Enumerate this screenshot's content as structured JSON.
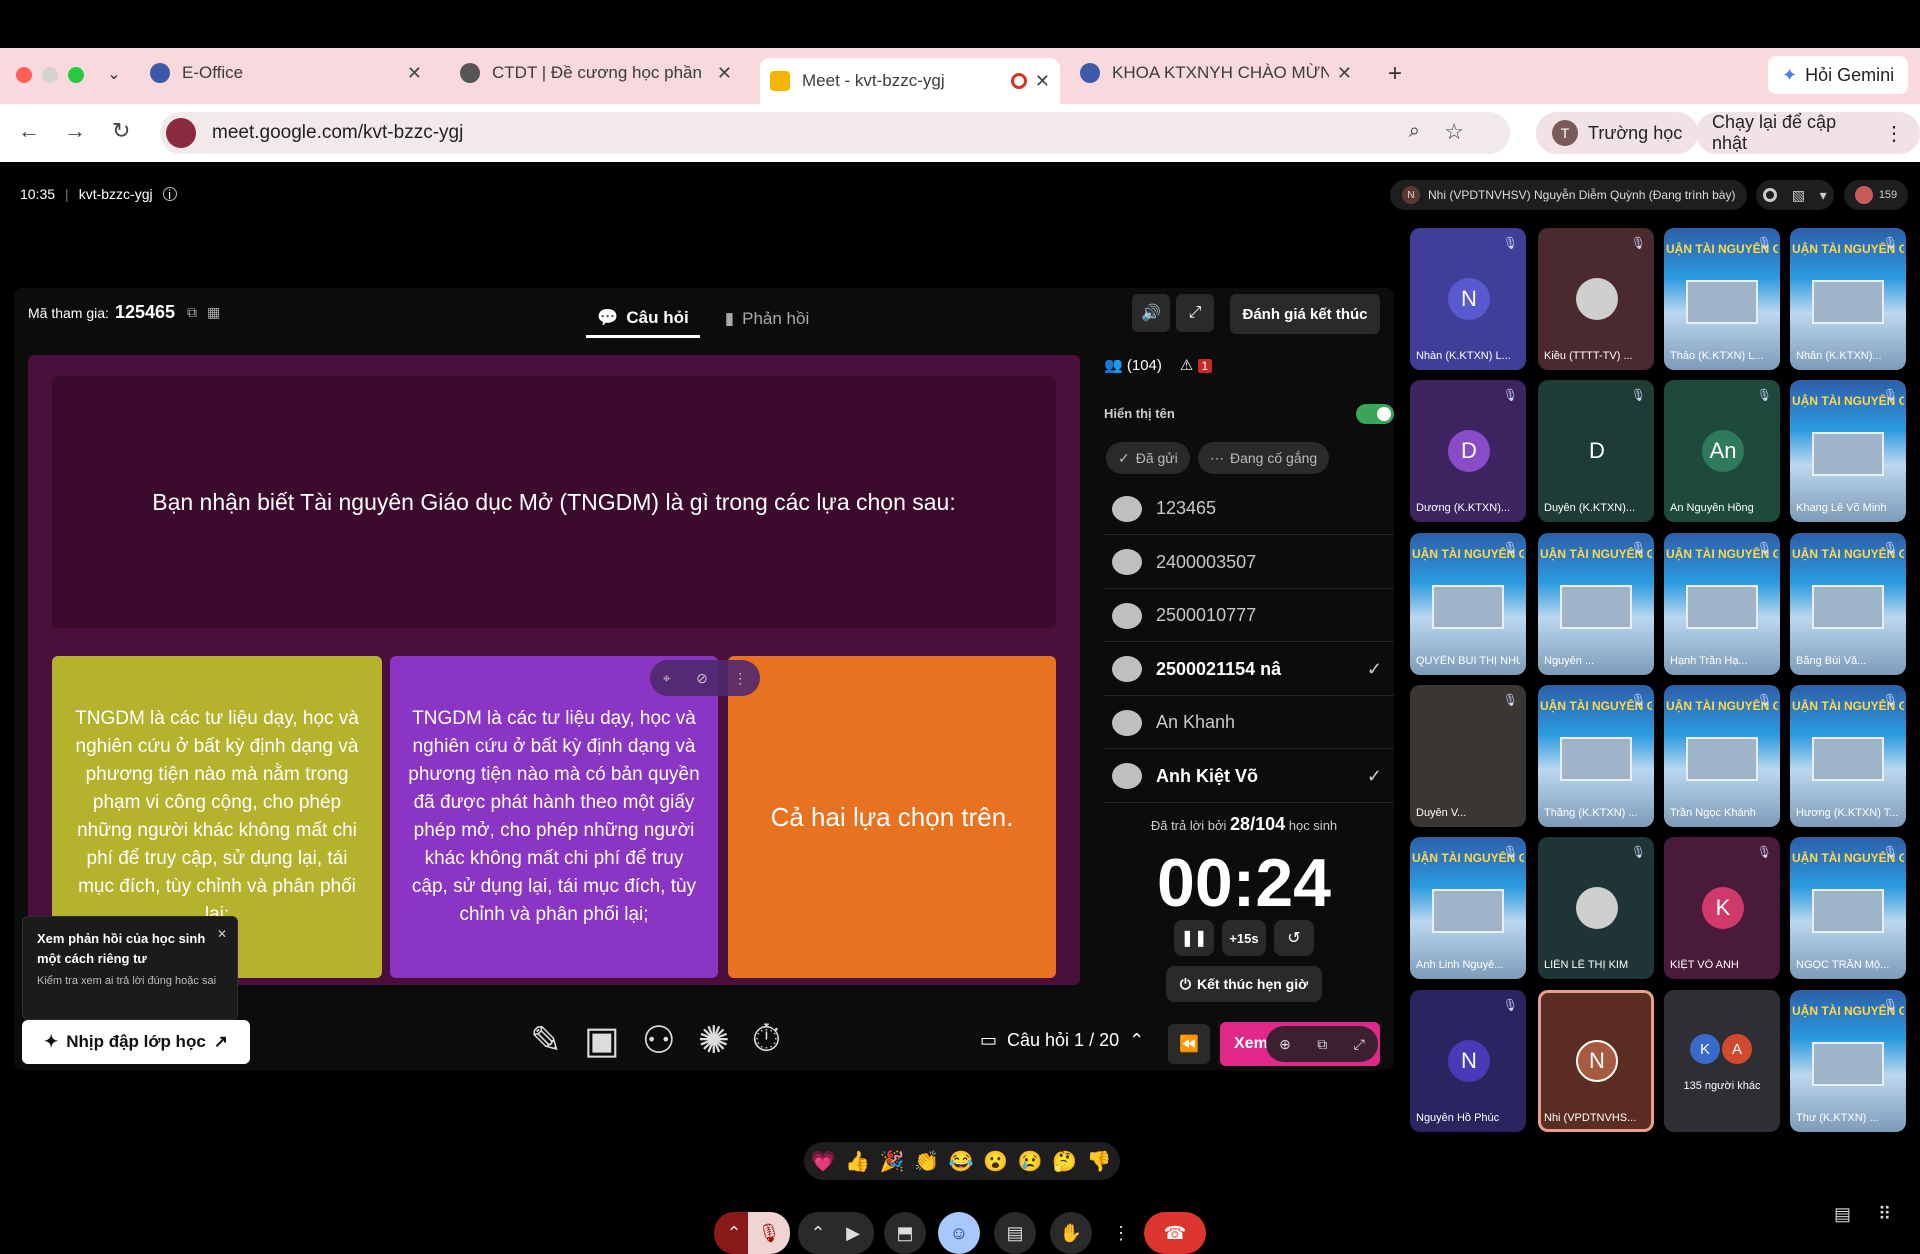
{
  "browser": {
    "tabs": [
      {
        "title": "E-Office",
        "color": "#3d5aa8"
      },
      {
        "title": "CTDT | Đề cương học phần",
        "color": "#555555"
      },
      {
        "title": "Meet - kvt-bzzc-ygj",
        "color": "#f4b400"
      },
      {
        "title": "KHOA KTXNYH CHÀO MỪNG",
        "color": "#3d5aa8"
      }
    ],
    "gemini_label": "Hỏi Gemini",
    "url": "meet.google.com/kvt-bzzc-ygj",
    "profile_initial": "T",
    "profile_label": "Trường học",
    "update_label": "Chạy lại để cập nhật"
  },
  "meet": {
    "time": "10:35",
    "separator": "|",
    "code": "kvt-bzzc-ygj",
    "presenter_initial": "N",
    "presenter": "Nhi (VPDTNVHSV) Nguyễn Diễm Quỳnh (Đang trình bày)",
    "participant_count": "159"
  },
  "quiz": {
    "join_label": "Mã tham gia:",
    "join_code": "125465",
    "tab_question": "Câu hỏi",
    "tab_response": "Phản hồi",
    "end_label": "Đánh giá kết thúc",
    "question": "Bạn nhận biết Tài nguyên Giáo dục Mở (TNGDM) là gì trong các lựa chọn sau:",
    "answers": [
      {
        "text": "TNGDM là các tư liệu dạy, học và nghiên cứu ở bất kỳ định dạng và phương tiện nào mà nằm trong phạm vi công cộng, cho phép những người khác không mất chi phí để truy cập, sử dụng lại, tái mục đích, tùy chỉnh và phân phối lại;",
        "color": "#b5b22e"
      },
      {
        "text": "TNGDM là các tư liệu dạy, học và nghiên cứu ở bất kỳ định dạng và phương tiện nào mà có bản quyền đã được phát hành theo một giấy phép mở, cho phép những người khác không mất chi phí để truy cập, sử dụng lại, tái mục đích, tùy chỉnh và phân phối lại;",
        "color": "#8a35c4"
      },
      {
        "text": "Cả hai lựa chọn trên.",
        "color": "#e8721f"
      }
    ],
    "participants": "(104)",
    "warnings": "1",
    "show_name": "Hiển thị tên",
    "filter_sent": "Đã gửi",
    "filter_trying": "Đang cố gắng",
    "students": [
      {
        "name": "123465",
        "check": ""
      },
      {
        "name": "2400003507",
        "check": ""
      },
      {
        "name": "2500010777",
        "check": ""
      },
      {
        "name": "2500021154 nâ",
        "check": "✓"
      },
      {
        "name": "An Khanh",
        "check": ""
      },
      {
        "name": "Anh Kiệt Võ",
        "check": "✓"
      }
    ],
    "answered_prefix": "Đã trả lời bởi",
    "answered": "28/104",
    "answered_suffix": "học sinh",
    "timer": "00:24",
    "plus": "+15s",
    "end_timer": "Kết thúc hẹn giờ",
    "counter": "Câu hỏi 1 / 20",
    "view_label": "Xem",
    "popup_title": "Xem phản hồi của học sinh một cách riêng tư",
    "popup_body": "Kiểm tra xem ai trả lời đúng hoặc sai",
    "pulse_label": "Nhịp đập lớp học"
  },
  "grid": {
    "poster_text": "UẬN TÀI NGUYÊN GIÁO DỤ",
    "tiles": [
      {
        "name": "Nhàn (K.KTXN) L...",
        "initial": "N",
        "bg": "#3f3f9a",
        "av": "#5a5ad0",
        "kind": "avatar"
      },
      {
        "name": "Kiều (TTTT-TV) ...",
        "initial": "",
        "bg": "#4a2a2e",
        "av": "#cfcfcf",
        "kind": "photo"
      },
      {
        "name": "Thảo (K.KTXN) L...",
        "initial": "",
        "bg": "",
        "av": "",
        "kind": "poster"
      },
      {
        "name": "Nhân (K.KTXN)...",
        "initial": "",
        "bg": "",
        "av": "",
        "kind": "poster"
      },
      {
        "name": "Dương (K.KTXN)...",
        "initial": "D",
        "bg": "#3d2460",
        "av": "#8a4bc8",
        "kind": "avatar"
      },
      {
        "name": "Duyên (K.KTXN)...",
        "initial": "D",
        "bg": "#1f3b35",
        "av": "#1f3b35",
        "kind": "avatar"
      },
      {
        "name": "An Nguyễn Hồng",
        "initial": "An",
        "bg": "#1d4a3d",
        "av": "#2f7a5c",
        "kind": "avatar"
      },
      {
        "name": "Khang Lê Võ Minh",
        "initial": "",
        "bg": "",
        "av": "",
        "kind": "poster"
      },
      {
        "name": "QUYÊN BÙI THỊ NHƯ",
        "initial": "",
        "bg": "",
        "av": "",
        "kind": "poster"
      },
      {
        "name": "Nguyên ...",
        "initial": "",
        "bg": "",
        "av": "",
        "kind": "poster"
      },
      {
        "name": "Hạnh Trần Hạ...",
        "initial": "",
        "bg": "",
        "av": "",
        "kind": "poster"
      },
      {
        "name": "Bằng Bùi Vă...",
        "initial": "",
        "bg": "",
        "av": "",
        "kind": "poster"
      },
      {
        "name": "Duyên V...",
        "initial": "",
        "bg": "#3a3632",
        "av": "",
        "kind": "dark"
      },
      {
        "name": "Thắng (K.KTXN) ...",
        "initial": "",
        "bg": "",
        "av": "",
        "kind": "poster"
      },
      {
        "name": "Trần Ngọc Khánh",
        "initial": "",
        "bg": "",
        "av": "",
        "kind": "poster"
      },
      {
        "name": "Hương (K.KTXN) T...",
        "initial": "",
        "bg": "",
        "av": "",
        "kind": "poster"
      },
      {
        "name": "Anh Linh Nguyễ...",
        "initial": "",
        "bg": "",
        "av": "",
        "kind": "poster"
      },
      {
        "name": "LIÊN LÊ THỊ KIM",
        "initial": "",
        "bg": "#1f3436",
        "av": "#cfcfcf",
        "kind": "photo"
      },
      {
        "name": "KIỆT VÕ ANH",
        "initial": "K",
        "bg": "#4a1a3a",
        "av": "#d03a6a",
        "kind": "avatar"
      },
      {
        "name": "NGỌC TRẦN Mộ...",
        "initial": "",
        "bg": "",
        "av": "",
        "kind": "poster"
      },
      {
        "name": "Nguyễn Hồ Phúc",
        "initial": "N",
        "bg": "#2a2460",
        "av": "#4a3ab8",
        "kind": "avatar"
      },
      {
        "name": "Nhi (VPDTNVHS...",
        "initial": "N",
        "bg": "#5a2c22",
        "av": "#a65a40",
        "kind": "speaking"
      },
      {
        "name": "135 người khác",
        "initial": "",
        "bg": "#2e2e34",
        "av": "",
        "kind": "others"
      },
      {
        "name": "Thư (K.KTXN) ...",
        "initial": "",
        "bg": "",
        "av": "",
        "kind": "poster"
      }
    ],
    "others_initials": [
      "K",
      "A"
    ]
  },
  "reactions": [
    "💗",
    "👍",
    "🎉",
    "👏",
    "😂",
    "😮",
    "😢",
    "🤔",
    "👎"
  ]
}
